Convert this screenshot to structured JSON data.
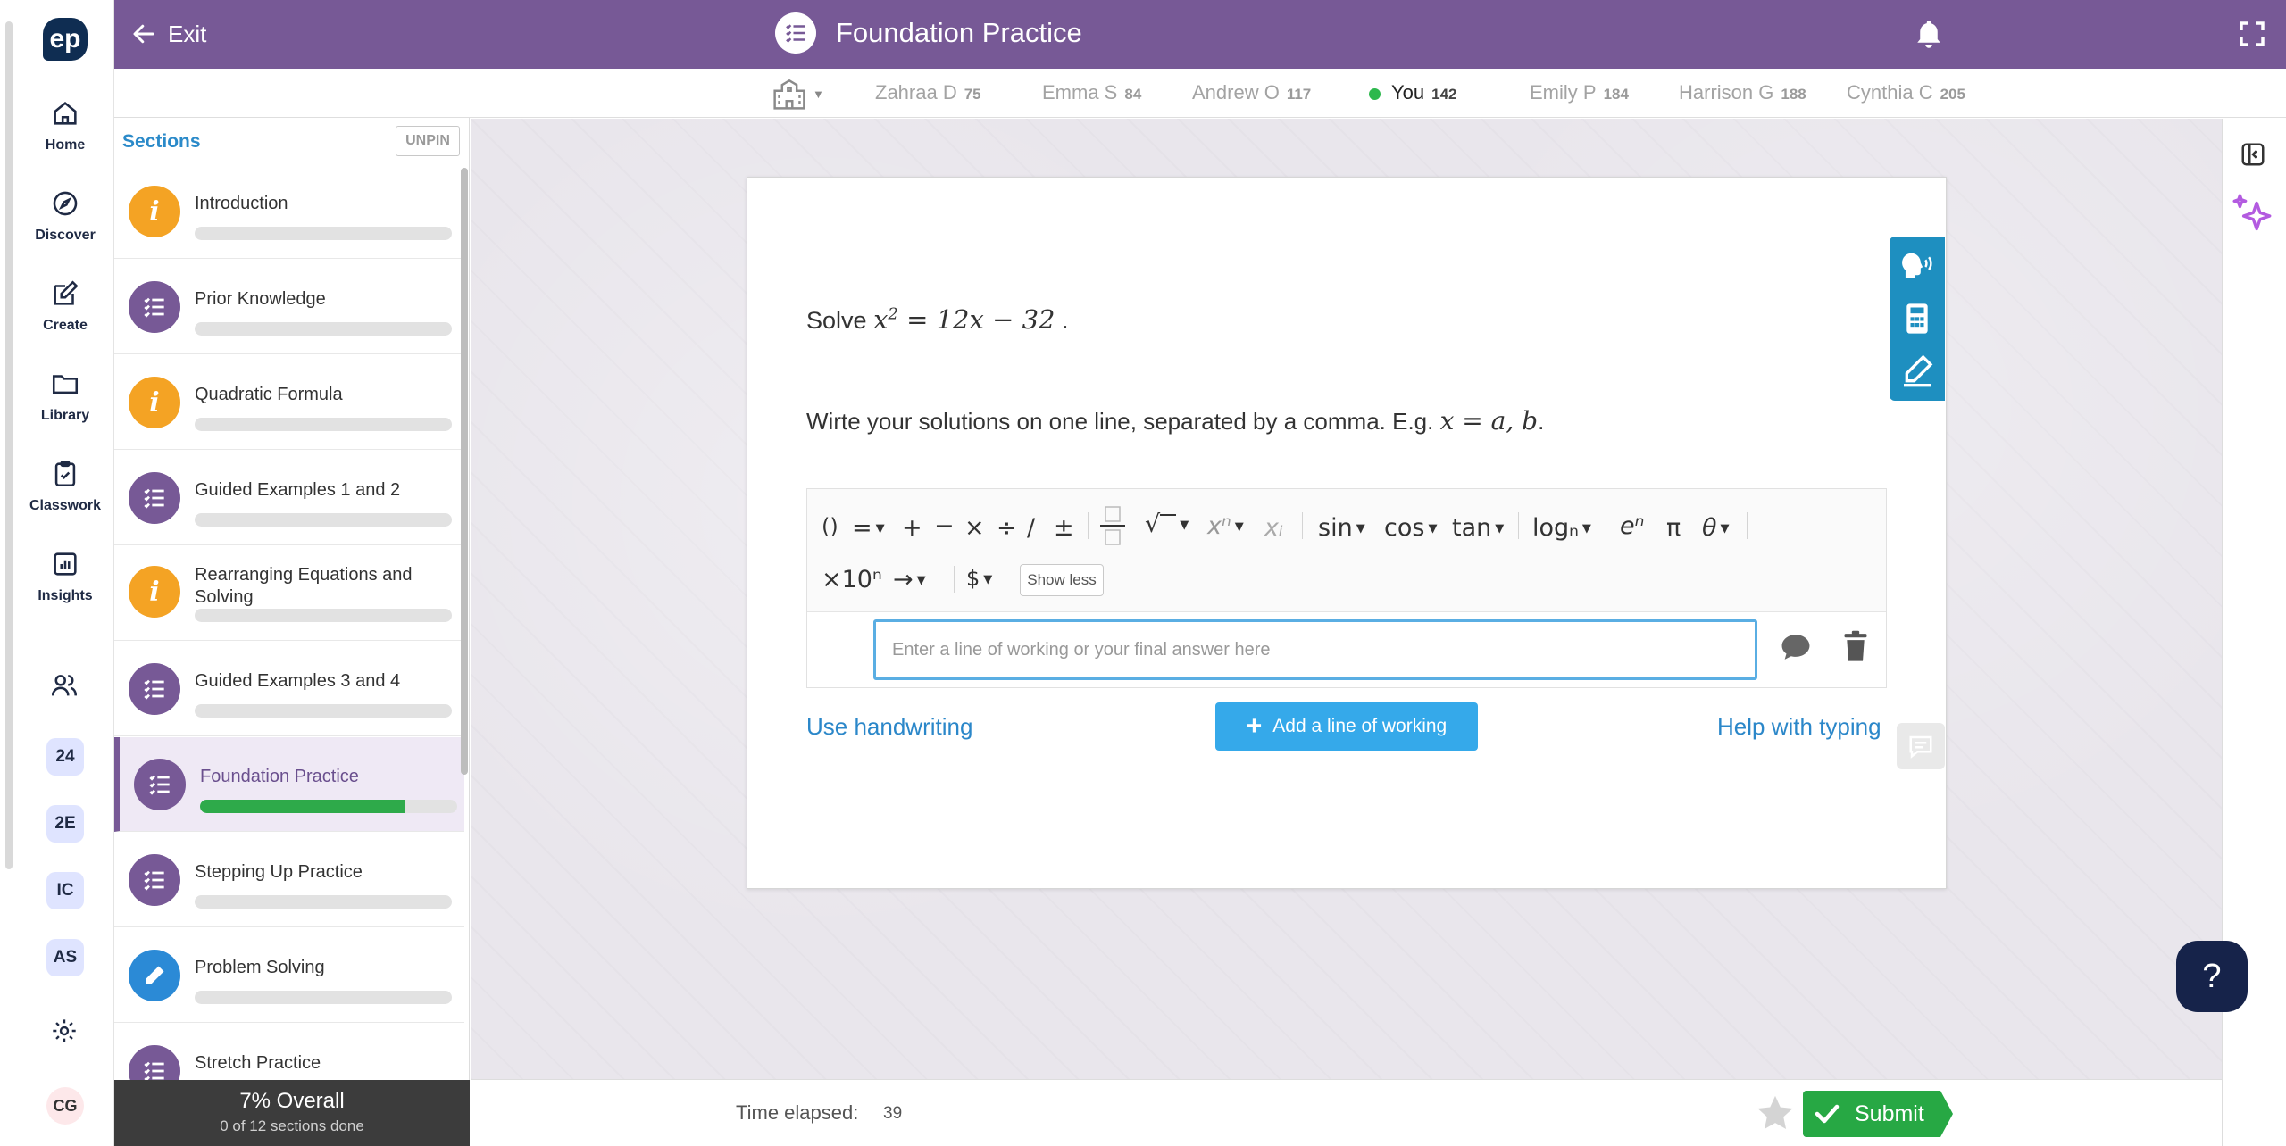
{
  "nav": {
    "logo": "ep",
    "items": [
      {
        "label": "Home",
        "icon": "home-icon"
      },
      {
        "label": "Discover",
        "icon": "compass-icon"
      },
      {
        "label": "Create",
        "icon": "edit-icon"
      },
      {
        "label": "Library",
        "icon": "folder-icon"
      },
      {
        "label": "Classwork",
        "icon": "clipboard-icon"
      },
      {
        "label": "Insights",
        "icon": "chart-icon"
      }
    ],
    "classes": [
      "24",
      "2E",
      "IC",
      "AS"
    ],
    "avatar": "CG"
  },
  "header": {
    "exit_label": "Exit",
    "title": "Foundation Practice",
    "bg_color": "#775996"
  },
  "leaderboard": [
    {
      "name": "Zahraa D",
      "score": "75"
    },
    {
      "name": "Emma S",
      "score": "84"
    },
    {
      "name": "Andrew O",
      "score": "117"
    },
    {
      "name": "You",
      "score": "142",
      "is_me": true
    },
    {
      "name": "Emily P",
      "score": "184"
    },
    {
      "name": "Harrison G",
      "score": "188"
    },
    {
      "name": "Cynthia C",
      "score": "205"
    }
  ],
  "sections": {
    "title": "Sections",
    "unpin_label": "UNPIN",
    "items": [
      {
        "label": "Introduction",
        "type": "info",
        "progress": 0
      },
      {
        "label": "Prior Knowledge",
        "type": "list",
        "progress": 0
      },
      {
        "label": "Quadratic Formula",
        "type": "info",
        "progress": 0
      },
      {
        "label": "Guided Examples 1 and 2",
        "type": "list",
        "progress": 0
      },
      {
        "label": "Rearranging Equations and Solving",
        "type": "info",
        "progress": 0
      },
      {
        "label": "Guided Examples 3 and 4",
        "type": "list",
        "progress": 0
      },
      {
        "label": "Foundation Practice",
        "type": "list",
        "progress": 0.8,
        "active": true
      },
      {
        "label": "Stepping Up Practice",
        "type": "list",
        "progress": 0
      },
      {
        "label": "Problem Solving",
        "type": "pencil",
        "progress": 0
      },
      {
        "label": "Stretch Practice",
        "type": "list",
        "progress": 0
      }
    ],
    "overall_pct": "7% Overall",
    "overall_sub": "0 of 12 sections done"
  },
  "question": {
    "prefix": "Solve",
    "equation_lhs": "x",
    "equation_exp": "2",
    "equation_rhs": "= 12x − 32",
    "suffix": ".",
    "instructions": "Wirte your solutions on one line, separated by a comma. E.g.",
    "example": "x = a, b",
    "example_suffix": "."
  },
  "toolbar": {
    "row1": [
      "()",
      "=",
      "+",
      "−",
      "×",
      "÷",
      "/",
      "±",
      "fraction",
      "√",
      "xⁿ",
      "xᵢ",
      "sin",
      "cos",
      "tan",
      "logₙ",
      "eⁿ",
      "π",
      "θ"
    ],
    "row2": [
      "×10ⁿ",
      "→",
      "$"
    ],
    "show_less": "Show less"
  },
  "answer": {
    "placeholder": "Enter a line of working or your final answer here",
    "value": ""
  },
  "actions": {
    "use_handwriting": "Use handwriting",
    "add_line": "Add a line of working",
    "help_typing": "Help with typing"
  },
  "footer": {
    "time_label": "Time elapsed:",
    "time_value": "39",
    "submit_label": "Submit",
    "submit_color": "#27a844"
  },
  "help_fab": "?"
}
